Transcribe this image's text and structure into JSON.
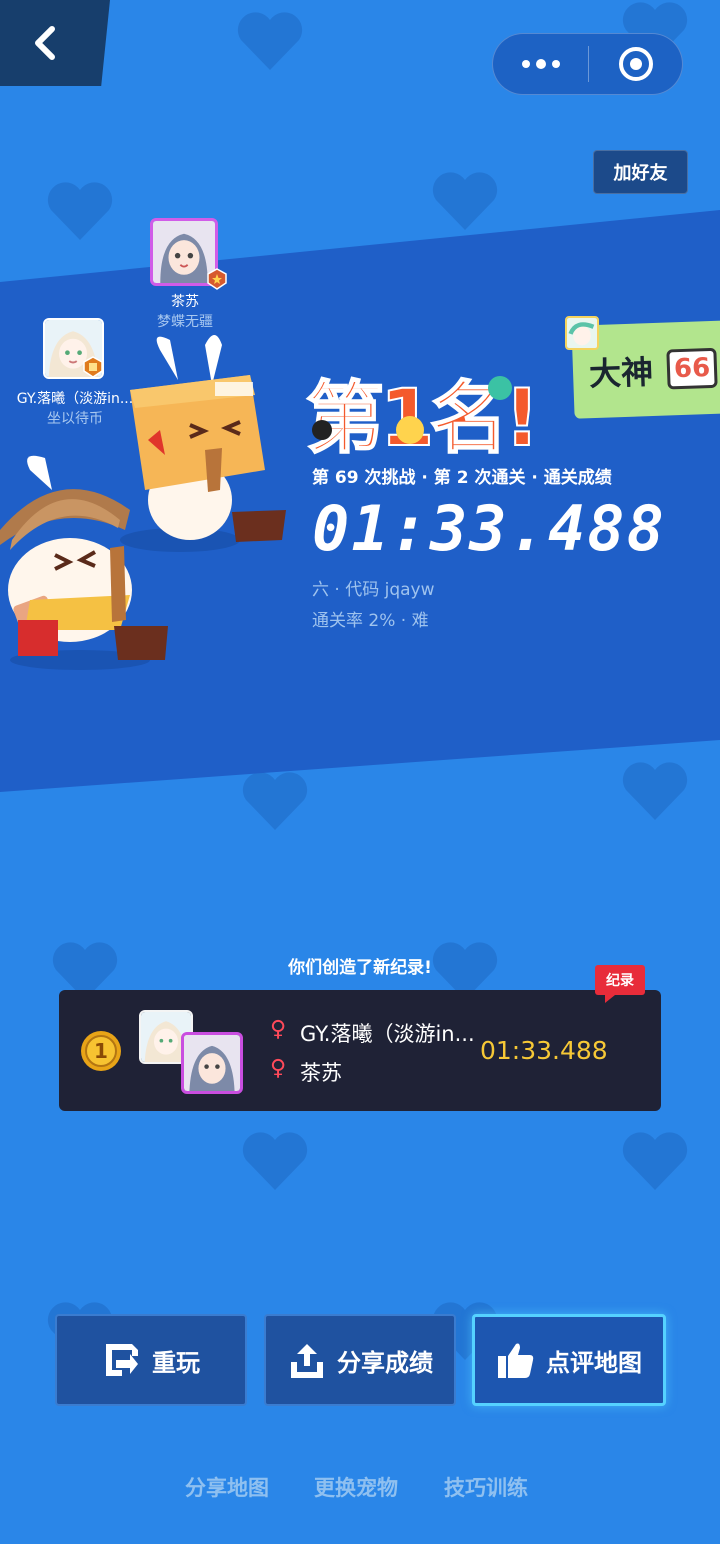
{
  "header": {
    "back_icon": "chevron-left-icon",
    "menu_icon": "more-dots-icon",
    "close_icon": "target-close-icon",
    "add_friend_label": "加好友"
  },
  "players": [
    {
      "name": "茶苏",
      "subtitle": "梦蝶无疆"
    },
    {
      "name": "GY.落曦（淡游in...",
      "subtitle": "坐以待币"
    }
  ],
  "result": {
    "title_image_text": "第1名!",
    "stats_line": "第 69 次挑战 · 第 2 次通关 · 通关成绩",
    "time": "01:33.488",
    "map_info": "六 · 代码 jqayw",
    "pass_info": "通关率 2% · 难"
  },
  "god_card": {
    "label": "大神",
    "stamp_text": "66"
  },
  "record": {
    "caption": "你们创造了新纪录!",
    "tag": "纪录",
    "rank": "1",
    "players": [
      "GY.落曦（淡游in...",
      "茶苏"
    ],
    "time": "01:33.488"
  },
  "actions": [
    {
      "label": "重玩",
      "icon": "replay-icon"
    },
    {
      "label": "分享成绩",
      "icon": "share-upload-icon"
    },
    {
      "label": "点评地图",
      "icon": "thumbs-up-icon"
    }
  ],
  "links": [
    "分享地图",
    "更换宠物",
    "技巧训练"
  ],
  "colors": {
    "background": "#2a86e8",
    "band": "#1f5fc8",
    "record_time": "#f6c836",
    "record_tag": "#e82c3a",
    "highlight_border": "#55d2ff"
  }
}
